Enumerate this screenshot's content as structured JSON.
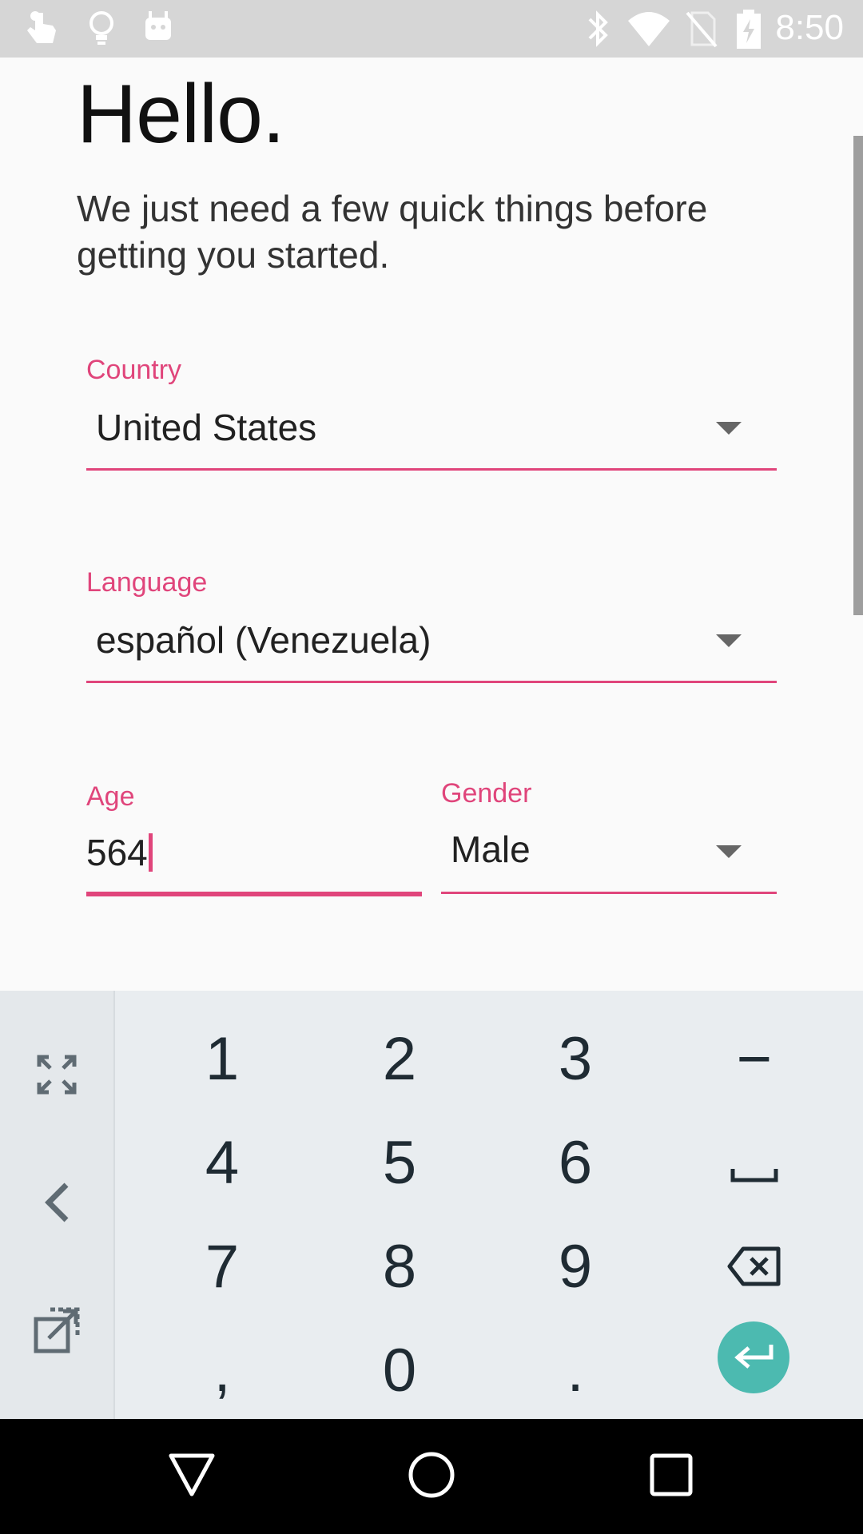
{
  "status_bar": {
    "time": "8:50",
    "left_icons": [
      "touch-icon",
      "lightbulb-icon",
      "android-icon"
    ],
    "right_icons": [
      "bluetooth-icon",
      "wifi-icon",
      "no-sim-icon",
      "battery-charging-icon"
    ]
  },
  "header": {
    "title": "Hello.",
    "intro": "We just need a few quick things before getting you started."
  },
  "form": {
    "country": {
      "label": "Country",
      "value": "United States"
    },
    "language": {
      "label": "Language",
      "value": "español (Venezuela)"
    },
    "age": {
      "label": "Age",
      "value": "564"
    },
    "gender": {
      "label": "Gender",
      "value": "Male"
    }
  },
  "keyboard": {
    "side_icons": [
      "fullscreen-icon",
      "back-chevron-icon",
      "popout-icon"
    ],
    "keys": {
      "k1": "1",
      "k2": "2",
      "k3": "3",
      "dash": "−",
      "k4": "4",
      "k5": "5",
      "k6": "6",
      "space": "space-icon",
      "k7": "7",
      "k8": "8",
      "k9": "9",
      "backspace": "backspace-icon",
      "comma": ",",
      "k0": "0",
      "period": ".",
      "enter": "enter-icon"
    }
  },
  "nav_bar": {
    "icons": [
      "back-triangle-icon",
      "home-circle-icon",
      "recents-square-icon"
    ]
  },
  "colors": {
    "accent": "#e0457b",
    "enter_button": "#4cbab0",
    "status_bar": "#d6d6d6",
    "keyboard_bg": "#e9edf0"
  }
}
